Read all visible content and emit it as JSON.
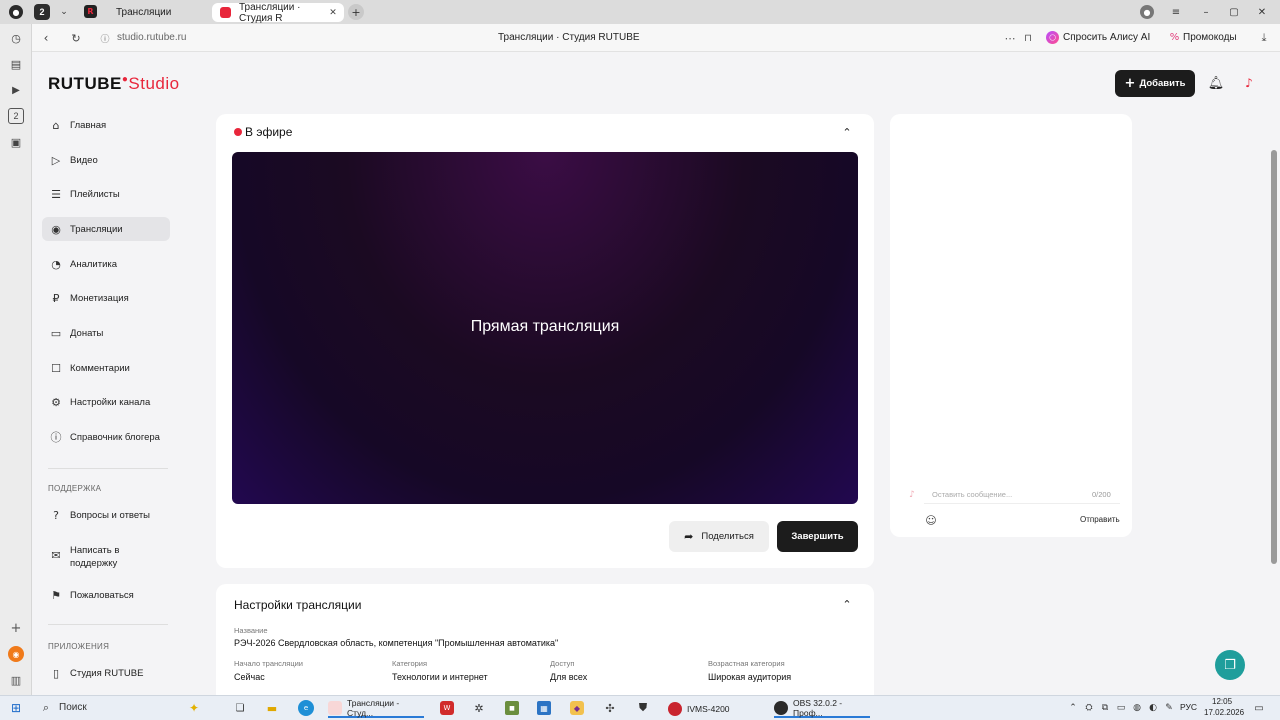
{
  "browser": {
    "tab_counter": "2",
    "tabs": [
      {
        "label": "Трансляции"
      },
      {
        "label": "Трансляции · Студия R"
      }
    ],
    "url": "studio.rutube.ru",
    "page_title": "Трансляции · Студия RUTUBE",
    "ask_alice": "Спросить Алису AI",
    "promo": "Промокоды",
    "vert_badge": "2"
  },
  "studio": {
    "logo_main": "RUTUBE",
    "logo_sub": "Studio",
    "add_button": "Добавить"
  },
  "sidebar": {
    "items": [
      {
        "label": "Главная",
        "icon": "home-icon"
      },
      {
        "label": "Видео",
        "icon": "video-icon"
      },
      {
        "label": "Плейлисты",
        "icon": "playlist-icon"
      },
      {
        "label": "Трансляции",
        "icon": "broadcast-icon"
      },
      {
        "label": "Аналитика",
        "icon": "analytics-icon"
      },
      {
        "label": "Монетизация",
        "icon": "money-icon"
      },
      {
        "label": "Донаты",
        "icon": "donate-icon"
      },
      {
        "label": "Комментарии",
        "icon": "comment-icon"
      },
      {
        "label": "Настройки канала",
        "icon": "gear-icon"
      },
      {
        "label": "Справочник блогера",
        "icon": "info-icon"
      }
    ],
    "support_header": "ПОДДЕРЖКА",
    "support_items": [
      {
        "label": "Вопросы и ответы",
        "icon": "question-icon"
      },
      {
        "label": "Написать в поддержку",
        "icon": "mail-icon"
      },
      {
        "label": "Пожаловаться",
        "icon": "flag-icon"
      }
    ],
    "apps_header": "ПРИЛОЖЕНИЯ",
    "apps_items": [
      {
        "label": "Студия RUTUBE",
        "icon": "app-icon"
      }
    ]
  },
  "live": {
    "status": "В эфире",
    "player_text": "Прямая трансляция",
    "share": "Поделиться",
    "finish": "Завершить"
  },
  "chat": {
    "placeholder": "Оставить сообщение...",
    "counter": "0/200",
    "send": "Отправить"
  },
  "settings": {
    "title": "Настройки трансляции",
    "name_label": "Название",
    "name_value": "РЭЧ-2026 Свердловская область, компетенция \"Промышленная автоматика\"",
    "fields": [
      {
        "label": "Начало трансляции",
        "value": "Сейчас"
      },
      {
        "label": "Категория",
        "value": "Технологии и интернет"
      },
      {
        "label": "Доступ",
        "value": "Для всех"
      },
      {
        "label": "Возрастная категория",
        "value": "Широкая аудитория"
      }
    ]
  },
  "taskbar": {
    "search": "Поиск",
    "items": [
      {
        "label": "Трансляции - Студ..."
      },
      {
        "label": "IVMS-4200"
      },
      {
        "label": "OBS 32.0.2 - Проф..."
      }
    ],
    "lang": "РУС",
    "time": "12:05",
    "date": "17.02.2026"
  },
  "colors": {
    "brand_red": "#e8263b",
    "dark": "#1c1c1c",
    "player_top": "#2a0a3a",
    "player_bottom": "#220850",
    "help_teal": "#1f9e9c"
  }
}
